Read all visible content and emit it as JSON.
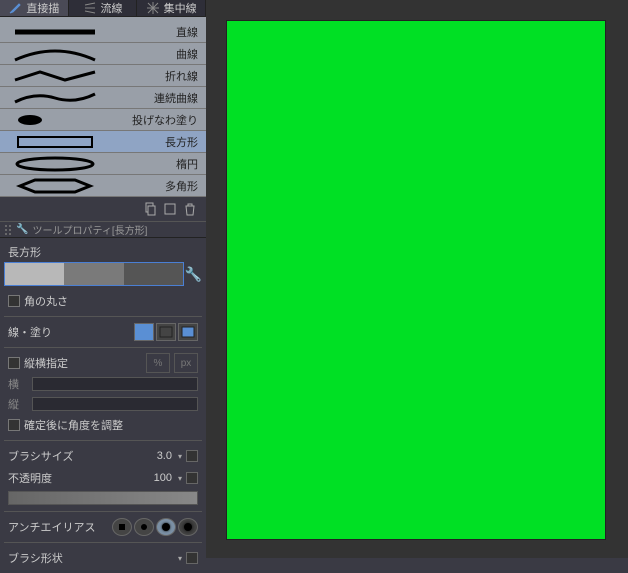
{
  "tabs": [
    {
      "label": "直接描",
      "active": true
    },
    {
      "label": "流線",
      "active": false
    },
    {
      "label": "集中線",
      "active": false
    }
  ],
  "tools": [
    {
      "label": "直線"
    },
    {
      "label": "曲線"
    },
    {
      "label": "折れ線"
    },
    {
      "label": "連続曲線"
    },
    {
      "label": "投げなわ塗り"
    },
    {
      "label": "長方形",
      "selected": true
    },
    {
      "label": "楕円"
    },
    {
      "label": "多角形"
    }
  ],
  "prop_header": "ツールプロパティ[長方形]",
  "selected_tool": "長方形",
  "props": {
    "corner_radius": "角の丸さ",
    "line_fill": "線・塗り",
    "aspect_lock": "縦横指定",
    "width": "横",
    "height": "縦",
    "adjust_after": "確定後に角度を調整",
    "brush_size": "ブラシサイズ",
    "brush_size_value": "3.0",
    "opacity": "不透明度",
    "opacity_value": "100",
    "antialias": "アンチエイリアス",
    "brush_shape": "ブラシ形状"
  }
}
